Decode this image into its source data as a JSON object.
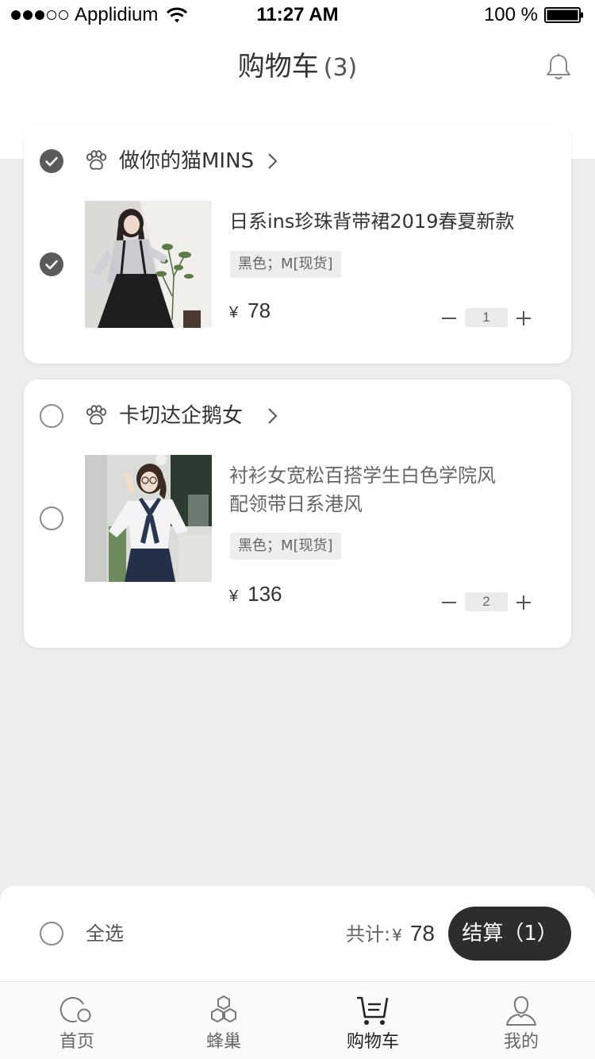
{
  "status_bar": {
    "carrier": "Applidium",
    "time": "11:27 AM",
    "battery": "100 %"
  },
  "header": {
    "title": "购物车",
    "count": "(3)"
  },
  "stores": [
    {
      "name": "做你的猫MINS",
      "selected": true,
      "items": [
        {
          "title": "日系ins珍珠背带裙2019春夏新款",
          "spec": "黑色；M[现货]",
          "currency": "¥",
          "price": "78",
          "quantity": "1",
          "selected": true
        }
      ]
    },
    {
      "name": "卡切达企鹅女",
      "selected": false,
      "items": [
        {
          "title_line1": "衬衫女宽松百搭学生白色学院风",
          "title_line2": "配领带日系港风",
          "spec": "黑色；M[现货]",
          "currency": "¥",
          "price": "136",
          "quantity": "2",
          "selected": false
        }
      ]
    }
  ],
  "checkout": {
    "select_all_label": "全选",
    "total_label": "共计:",
    "currency": "¥",
    "total_amount": "78",
    "button_label": "结算（1）"
  },
  "tabs": [
    {
      "label": "首页",
      "icon": "home-icon",
      "active": false
    },
    {
      "label": "蜂巢",
      "icon": "hive-icon",
      "active": false
    },
    {
      "label": "购物车",
      "icon": "cart-icon",
      "active": true
    },
    {
      "label": "我的",
      "icon": "profile-icon",
      "active": false
    }
  ],
  "colors": {
    "background": "#ededed",
    "card": "#ffffff",
    "checked": "#5a5a5a",
    "button": "#2d2d2d"
  }
}
